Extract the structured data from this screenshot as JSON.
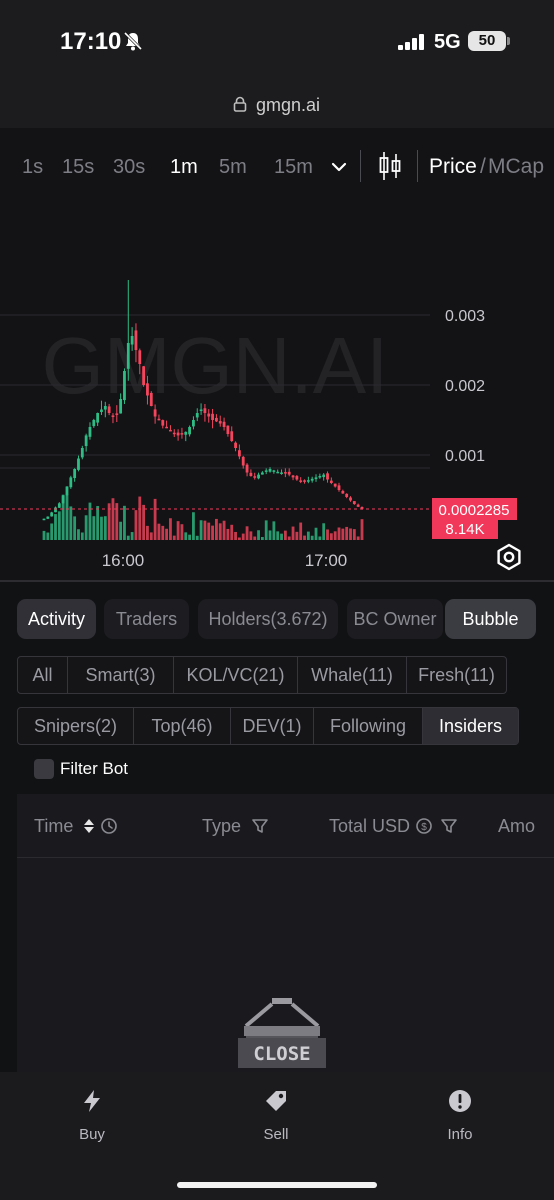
{
  "status": {
    "time": "17:10",
    "network": "5G",
    "battery": "50"
  },
  "browser": {
    "url": "gmgn.ai"
  },
  "timeframes": [
    "1s",
    "15s",
    "30s",
    "1m",
    "5m",
    "15m"
  ],
  "active_timeframe": "1m",
  "price_toggle": {
    "price": "Price",
    "sep": "/",
    "mcap": "MCap"
  },
  "chart": {
    "watermark": "GMGN.AI",
    "y_ticks": [
      "0.003",
      "0.002",
      "0.001"
    ],
    "x_ticks": [
      "16:00",
      "17:00"
    ],
    "current_price_label": "0.0002285",
    "volume_label": "8.14K"
  },
  "tabs": [
    "Activity",
    "Traders",
    "Holders(3.672)",
    "BC Owner",
    "Bubble"
  ],
  "filters_row1": [
    "All",
    "Smart(3)",
    "KOL/VC(21)",
    "Whale(11)",
    "Fresh(11)"
  ],
  "filters_row2": [
    "Snipers(2)",
    "Top(46)",
    "DEV(1)",
    "Following",
    "Insiders"
  ],
  "filter_bot_label": "Filter Bot",
  "table_headers": [
    "Time",
    "Type",
    "Total USD",
    "Amo"
  ],
  "close_sign_text": "CLOSE",
  "bottom_nav": [
    "Buy",
    "Sell",
    "Info"
  ],
  "colors": {
    "up": "#2ebd85",
    "down": "#f6465d",
    "accent_label": "#f2385a"
  },
  "chart_data": {
    "type": "candlestick",
    "y_ticks": [
      0.003,
      0.002,
      0.001
    ],
    "x_ticks": [
      "16:00",
      "17:00"
    ],
    "last_price": 0.0002285,
    "last_volume": "8.14K",
    "price_path": [
      9e-05,
      0.00012,
      0.00018,
      0.00025,
      0.00031,
      0.00042,
      0.00055,
      0.00068,
      0.0008,
      0.00095,
      0.0011,
      0.00128,
      0.0014,
      0.0015,
      0.0016,
      0.00165,
      0.0017,
      0.0016,
      0.00155,
      0.00158,
      0.0018,
      0.0022,
      0.0026,
      0.0027,
      0.0025,
      0.0023,
      0.002,
      0.00185,
      0.0017,
      0.00155,
      0.0015,
      0.00142,
      0.0014,
      0.00135,
      0.0013,
      0.00128,
      0.0013,
      0.00133,
      0.0014,
      0.0015,
      0.0016,
      0.00165,
      0.0016,
      0.00155,
      0.0015,
      0.00148,
      0.00145,
      0.0014,
      0.0013,
      0.0012,
      0.0011,
      0.00098,
      0.00085,
      0.00075,
      0.0007,
      0.00068,
      0.00072,
      0.00075,
      0.00078,
      0.0008,
      0.00078,
      0.00076,
      0.00075,
      0.00074,
      0.00072,
      0.00068,
      0.00065,
      0.00063,
      0.00062,
      0.00064,
      0.00066,
      0.00068,
      0.0007,
      0.00072,
      0.00065,
      0.0006,
      0.00055,
      0.0005,
      0.00045,
      0.0004,
      0.00035,
      0.0003,
      0.00026,
      0.00023
    ]
  }
}
